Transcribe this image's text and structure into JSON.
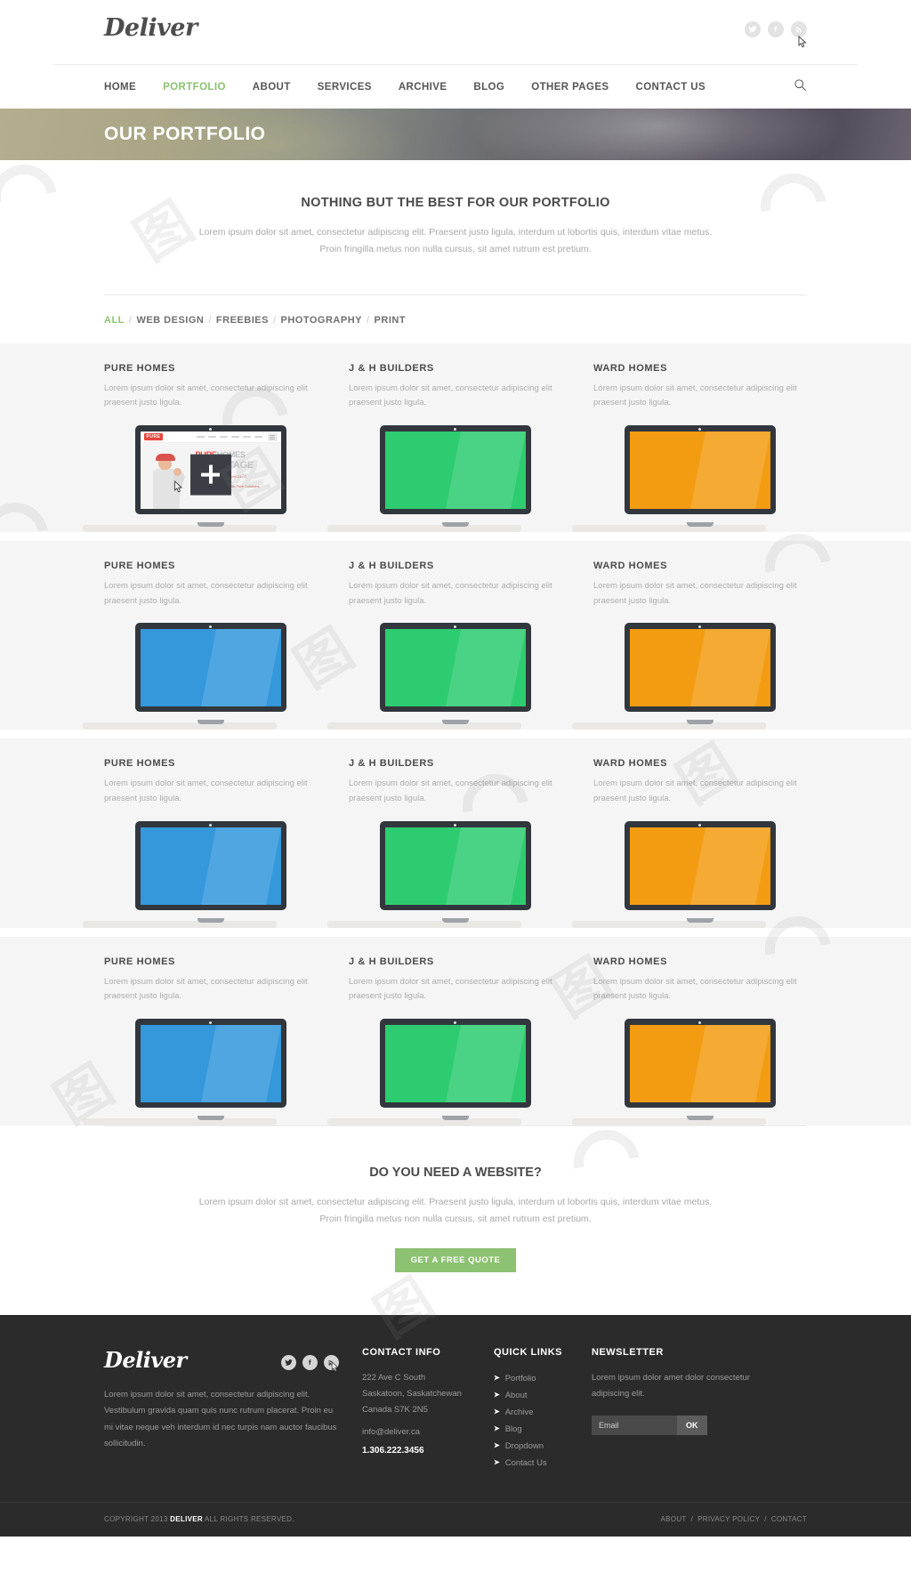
{
  "header": {
    "logo": "Deliver",
    "social": [
      {
        "name": "twitter-icon",
        "label": "Twitter"
      },
      {
        "name": "facebook-icon",
        "label": "Facebook"
      },
      {
        "name": "rss-icon",
        "label": "RSS"
      }
    ],
    "nav": [
      {
        "label": "HOME",
        "active": false
      },
      {
        "label": "PORTFOLIO",
        "active": true
      },
      {
        "label": "ABOUT",
        "active": false
      },
      {
        "label": "SERVICES",
        "active": false
      },
      {
        "label": "ARCHIVE",
        "active": false
      },
      {
        "label": "BLOG",
        "active": false
      },
      {
        "label": "OTHER PAGES",
        "active": false
      },
      {
        "label": "CONTACT US",
        "active": false
      }
    ],
    "search_icon": "search-icon"
  },
  "hero": {
    "title": "OUR PORTFOLIO"
  },
  "intro": {
    "heading": "NOTHING BUT THE BEST FOR OUR PORTFOLIO",
    "body": "Lorem ipsum dolor sit amet, consectetur adipiscing elit. Praesent justo ligula, interdum ut lobortis quis, interdum vitae metus. Proin fringilla metus non nulla cursus, sit amet rutrum est pretium."
  },
  "filters": [
    {
      "label": "ALL",
      "active": true
    },
    {
      "label": "WEB DESIGN",
      "active": false
    },
    {
      "label": "FREEBIES",
      "active": false
    },
    {
      "label": "PHOTOGRAPHY",
      "active": false
    },
    {
      "label": "PRINT",
      "active": false
    }
  ],
  "portfolio": {
    "desc": "Lorem ipsum dolor sit amet, consectetur adipiscing elit praesent justo ligula.",
    "overlay_icon": "plus-icon",
    "featured_site": {
      "logo": "PURE",
      "logo_sub": "HOMES",
      "headline_red": "PURE",
      "headline_gray": "HOMES",
      "headline2": "ADVANTAGE",
      "sub1": "Having all trades Services 24 / 7",
      "sub2": "Professional Homes With Pure Solutions"
    },
    "rows": [
      {
        "items": [
          {
            "title": "PURE HOMES",
            "color": "#3498db",
            "featured": true
          },
          {
            "title": "J & H BUILDERS",
            "color": "#2ecc71",
            "featured": false
          },
          {
            "title": "WARD HOMES",
            "color": "#f39c12",
            "featured": false
          }
        ]
      },
      {
        "items": [
          {
            "title": "PURE HOMES",
            "color": "#3498db",
            "featured": false
          },
          {
            "title": "J & H BUILDERS",
            "color": "#2ecc71",
            "featured": false
          },
          {
            "title": "WARD HOMES",
            "color": "#f39c12",
            "featured": false
          }
        ]
      },
      {
        "items": [
          {
            "title": "PURE HOMES",
            "color": "#3498db",
            "featured": false
          },
          {
            "title": "J & H BUILDERS",
            "color": "#2ecc71",
            "featured": false
          },
          {
            "title": "WARD HOMES",
            "color": "#f39c12",
            "featured": false
          }
        ]
      },
      {
        "items": [
          {
            "title": "PURE HOMES",
            "color": "#3498db",
            "featured": false
          },
          {
            "title": "J & H BUILDERS",
            "color": "#2ecc71",
            "featured": false
          },
          {
            "title": "WARD HOMES",
            "color": "#f39c12",
            "featured": false
          }
        ]
      }
    ]
  },
  "cta": {
    "heading": "DO YOU NEED A WEBSITE?",
    "body": "Lorem ipsum dolor sit amet, consectetur adipiscing elit. Praesent justo ligula, interdum ut lobortis quis, interdum vitae metus. Proin fringilla metus non nulla cursus, sit amet rutrum est pretium.",
    "button": "GET A FREE QUOTE"
  },
  "footer": {
    "logo": "Deliver",
    "social": [
      {
        "name": "twitter-icon",
        "label": "Twitter"
      },
      {
        "name": "facebook-icon",
        "label": "Facebook"
      },
      {
        "name": "rss-icon",
        "label": "RSS"
      }
    ],
    "about": "Lorem ipsum dolor sit amet, consectetur adipiscing elit. Vestibulum gravida quam quis nunc rutrum placerat. Proin eu mi vitae neque veh interdum id nec turpis nam auctor faucibus sollicitudin.",
    "contact": {
      "heading": "CONTACT INFO",
      "address1": "222 Ave C South",
      "address2": "Saskatoon, Saskatchewan",
      "address3": "Canada S7K 2N5",
      "email": "info@deliver.ca",
      "phone": "1.306.222.3456"
    },
    "quick_links": {
      "heading": "QUICK LINKS",
      "items": [
        "Portfolio",
        "About",
        "Archive",
        "Blog",
        "Dropdown",
        "Contact Us"
      ]
    },
    "newsletter": {
      "heading": "NEWSLETTER",
      "body": "Lorem ipsum dolor amet dolor consectetur adipiscing elit.",
      "placeholder": "Email",
      "value": "",
      "button": "OK"
    },
    "bottom": {
      "copyright_pre": "COPYRIGHT 2013",
      "copyright_brand": "DELIVER",
      "copyright_post": "ALL RIGHTS RESERVED.",
      "links": [
        "ABOUT",
        "PRIVACY POLICY",
        "CONTACT"
      ]
    }
  },
  "colors": {
    "accent_green": "#8cc271",
    "footer_bg": "#2b2b2b",
    "laptop_body": "#32373d",
    "screen_blue": "#3498db",
    "screen_green": "#2ecc71",
    "screen_orange": "#f39c12"
  }
}
